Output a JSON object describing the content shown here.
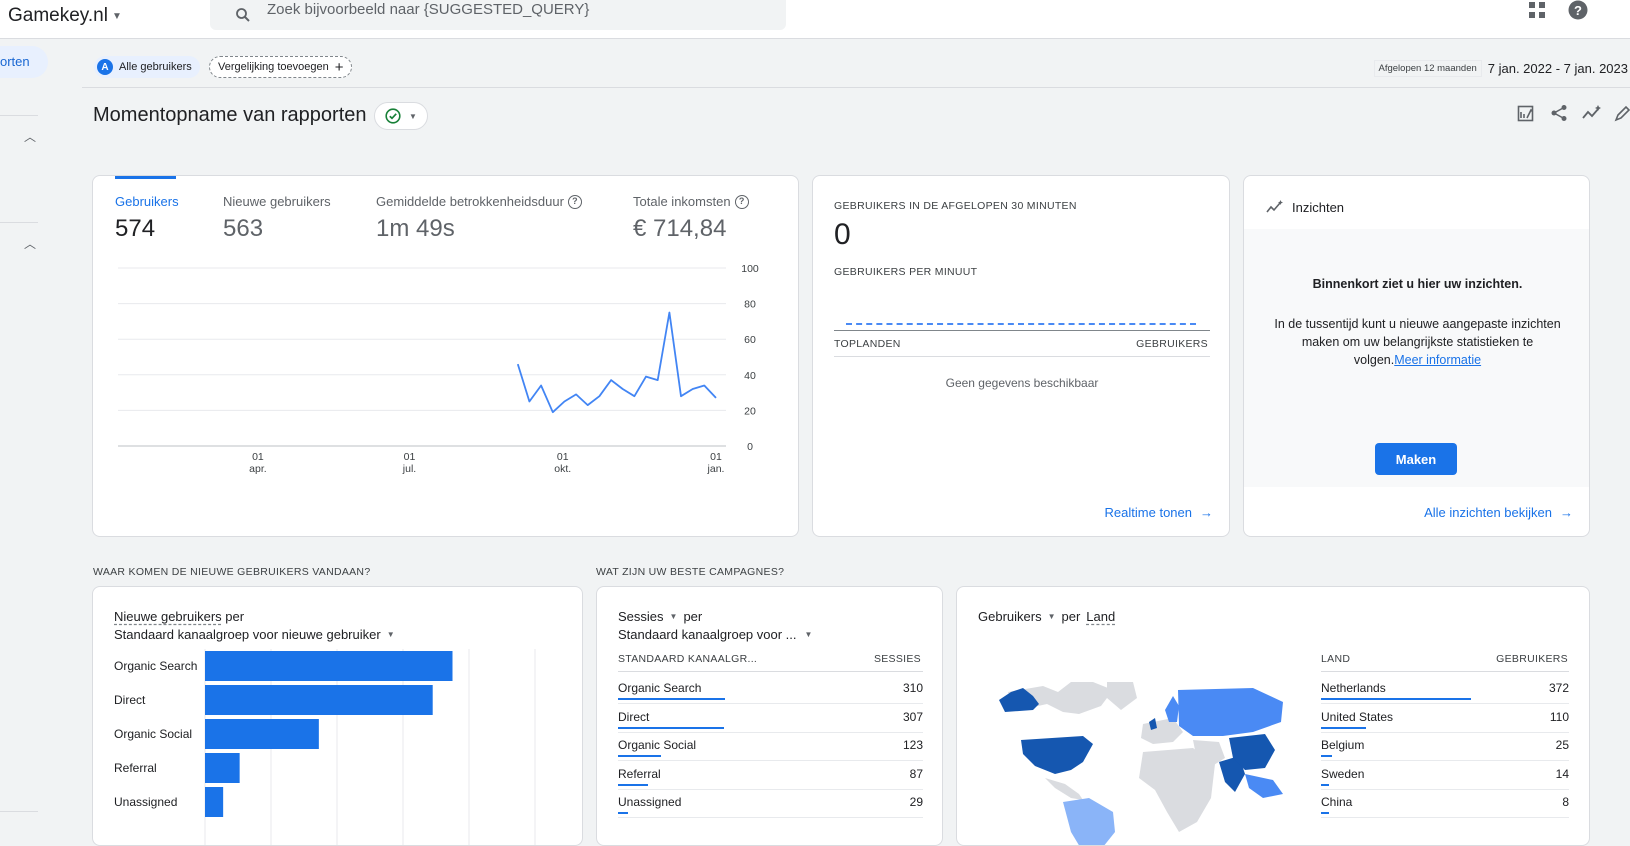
{
  "header": {
    "property_name": "Gamekey.nl",
    "search_placeholder": "Zoek bijvoorbeeld naar {SUGGESTED_QUERY}"
  },
  "sidebar": {
    "active_item_label": "orten"
  },
  "filters": {
    "segment_avatar": "A",
    "segment_label": "Alle gebruikers",
    "comparison_label": "Vergelijking toevoegen",
    "period_badge": "Afgelopen 12 maanden",
    "date_range": "7 jan. 2022 - 7 jan. 2023"
  },
  "page": {
    "title": "Momentopname van rapporten"
  },
  "overview": {
    "metrics": [
      {
        "label": "Gebruikers",
        "value": "574"
      },
      {
        "label": "Nieuwe gebruikers",
        "value": "563"
      },
      {
        "label": "Gemiddelde betrokkenheidsduur",
        "value": "1m 49s"
      },
      {
        "label": "Totale inkomsten",
        "value": "€ 714,84"
      }
    ]
  },
  "chart_data": [
    {
      "type": "line",
      "title": "",
      "xlabel": "",
      "ylabel": "",
      "ylim": [
        0,
        100
      ],
      "yticks": [
        "100",
        "80",
        "60",
        "40",
        "20",
        "0"
      ],
      "xticks": [
        {
          "day": "01",
          "month": "apr."
        },
        {
          "day": "01",
          "month": "jul."
        },
        {
          "day": "01",
          "month": "okt."
        },
        {
          "day": "01",
          "month": "jan."
        }
      ],
      "grid": true,
      "series": [
        {
          "x": [
            "2022-09-04",
            "2022-09-11",
            "2022-09-18",
            "2022-09-25",
            "2022-10-02",
            "2022-10-09",
            "2022-10-16",
            "2022-10-23",
            "2022-10-30",
            "2022-11-06",
            "2022-11-13",
            "2022-11-20",
            "2022-11-27",
            "2022-12-04",
            "2022-12-11",
            "2022-12-18",
            "2022-12-25",
            "2023-01-01"
          ],
          "values": [
            46,
            25,
            34,
            19,
            25,
            29,
            23,
            28,
            37,
            32,
            28,
            39,
            37,
            75,
            28,
            32,
            34,
            27
          ]
        }
      ]
    },
    {
      "type": "bar",
      "orientation": "horizontal",
      "title": "Nieuwe gebruikers per Standaard kanaalgroep voor nieuwe gebruiker",
      "categories": [
        "Organic Search",
        "Direct",
        "Organic Social",
        "Referral",
        "Unassigned"
      ],
      "values": [
        300,
        276,
        138,
        42,
        22
      ],
      "grid": true
    }
  ],
  "realtime": {
    "heading": "GEBRUIKERS IN DE AFGELOPEN 30 MINUTEN",
    "value": "0",
    "per_minute_label": "GEBRUIKERS PER MINUUT",
    "col_country": "TOPLANDEN",
    "col_users": "GEBRUIKERS",
    "empty_text": "Geen gegevens beschikbaar",
    "link": "Realtime tonen"
  },
  "insights": {
    "title": "Inzichten",
    "headline": "Binnenkort ziet u hier uw inzichten.",
    "body": "In de tussentijd kunt u nieuwe aangepaste inzichten maken om uw belangrijkste statistieken te volgen.",
    "learn_more": "Meer informatie",
    "button": "Maken",
    "link": "Alle inzichten bekijken"
  },
  "sections": {
    "new_users_heading": "WAAR KOMEN DE NIEUWE GEBRUIKERS VANDAAN?",
    "campaigns_heading": "WAT ZIJN UW BESTE CAMPAGNES?"
  },
  "new_users_card": {
    "metric": "Nieuwe gebruikers",
    "per": "per",
    "dimension": "Standaard kanaalgroep voor nieuwe gebruiker"
  },
  "campaigns_card": {
    "metric": "Sessies",
    "per": "per",
    "dimension": "Standaard kanaalgroep voor ...",
    "col_dimension": "STANDAARD KANAALGR...",
    "col_metric": "SESSIES",
    "rows": [
      {
        "label": "Organic Search",
        "value": "310",
        "fraction": 1.0
      },
      {
        "label": "Direct",
        "value": "307",
        "fraction": 0.99
      },
      {
        "label": "Organic Social",
        "value": "123",
        "fraction": 0.4
      },
      {
        "label": "Referral",
        "value": "87",
        "fraction": 0.28
      },
      {
        "label": "Unassigned",
        "value": "29",
        "fraction": 0.09
      }
    ]
  },
  "country_card": {
    "metric": "Gebruikers",
    "per": "per",
    "dimension": "Land",
    "col_country": "LAND",
    "col_users": "GEBRUIKERS",
    "rows": [
      {
        "label": "Netherlands",
        "value": "372",
        "fraction": 1.0
      },
      {
        "label": "United States",
        "value": "110",
        "fraction": 0.3
      },
      {
        "label": "Belgium",
        "value": "25",
        "fraction": 0.07
      },
      {
        "label": "Sweden",
        "value": "14",
        "fraction": 0.04
      },
      {
        "label": "China",
        "value": "8",
        "fraction": 0.02
      }
    ]
  },
  "colors": {
    "accent": "#1a73e8",
    "map_dark": "#1557b0",
    "map_mid": "#4a8af4",
    "map_light": "#8ab4f8",
    "map_none": "#dadce0"
  }
}
